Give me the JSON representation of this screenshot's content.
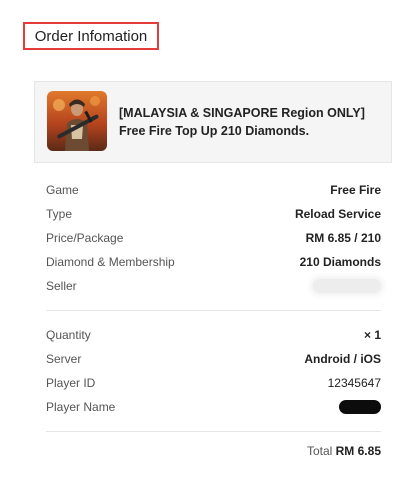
{
  "header": {
    "title": "Order Infomation"
  },
  "product": {
    "name": "[MALAYSIA & SINGAPORE Region ONLY] Free Fire Top Up 210 Diamonds.",
    "thumbnail_icon": "game-character-thumbnail-icon"
  },
  "details": {
    "game_label": "Game",
    "game_value": "Free Fire",
    "type_label": "Type",
    "type_value": "Reload Service",
    "price_label": "Price/Package",
    "price_value": "RM 6.85 / 210",
    "diamond_label": "Diamond & Membership",
    "diamond_value": "210 Diamonds",
    "seller_label": "Seller"
  },
  "order": {
    "quantity_label": "Quantity",
    "quantity_value": "× 1",
    "server_label": "Server",
    "server_value": "Android / iOS",
    "player_id_label": "Player ID",
    "player_id_value": "12345647",
    "player_name_label": "Player Name"
  },
  "summary": {
    "total_label": "Total",
    "total_value": "RM 6.85"
  },
  "colors": {
    "highlight_border": "#e53b3b",
    "card_bg": "#f5f5f5"
  }
}
